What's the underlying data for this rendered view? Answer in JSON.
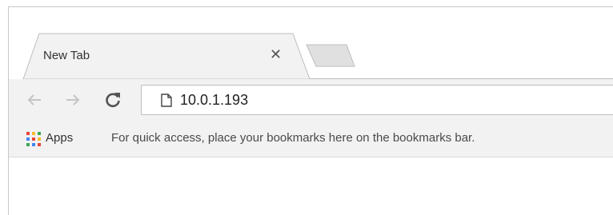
{
  "tabs": [
    {
      "title": "New Tab",
      "active": true
    }
  ],
  "toolbar": {
    "url": "10.0.1.193"
  },
  "bookmarks_bar": {
    "apps_label": "Apps",
    "hint": "For quick access, place your bookmarks here on the bookmarks bar."
  },
  "colors": {
    "toolbar_bg": "#f2f2f2",
    "apps_red": "#e8453c",
    "apps_yellow": "#f9bb2d",
    "apps_green": "#3aa757",
    "apps_blue": "#4285f4"
  },
  "icons": [
    "back-arrow-icon",
    "forward-arrow-icon",
    "reload-icon",
    "page-icon",
    "apps-grid-icon",
    "close-icon"
  ]
}
